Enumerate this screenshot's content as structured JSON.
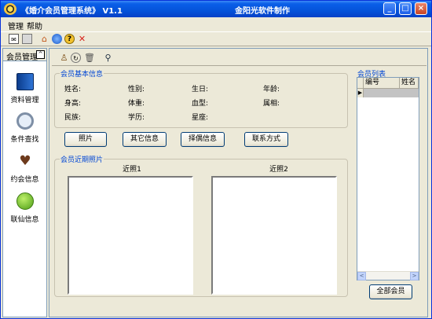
{
  "titlebar": {
    "title": "《婚介会员管理系统》 V1.1",
    "center_text": "金阳光软件制作",
    "minimize": "_",
    "maximize": "□",
    "close": "×"
  },
  "menu": [
    "管理",
    "帮助"
  ],
  "toolbar_icons": [
    "mail-icon",
    "documents-icon",
    "home-icon",
    "globe-icon",
    "help-icon",
    "close-icon"
  ],
  "nav": {
    "header": "会员管理",
    "collapse": "^",
    "items": [
      {
        "label": "资料管理",
        "icon": "book-icon"
      },
      {
        "label": "条件查找",
        "icon": "magnifier-icon"
      },
      {
        "label": "约会信息",
        "icon": "couple-icon"
      },
      {
        "label": "联仙信息",
        "icon": "leaf-icon"
      }
    ]
  },
  "basic_info": {
    "title": "会员基本信息",
    "rows": [
      [
        "姓名:",
        "性别:",
        "生日:",
        "年龄:"
      ],
      [
        "身高:",
        "体重:",
        "血型:",
        "属相:"
      ],
      [
        "民族:",
        "学历:",
        "星座:"
      ]
    ]
  },
  "buttons": [
    "照片",
    "其它信息",
    "择偶信息",
    "联系方式"
  ],
  "photos": {
    "title": "会员近期照片",
    "photo1": "近照1",
    "photo2": "近照2"
  },
  "member_list": {
    "title": "会员列表",
    "columns": [
      "编号",
      "姓名"
    ],
    "row_indicator": "▶",
    "all_button": "全部会员",
    "scroll_left": "<",
    "scroll_right": ">"
  }
}
